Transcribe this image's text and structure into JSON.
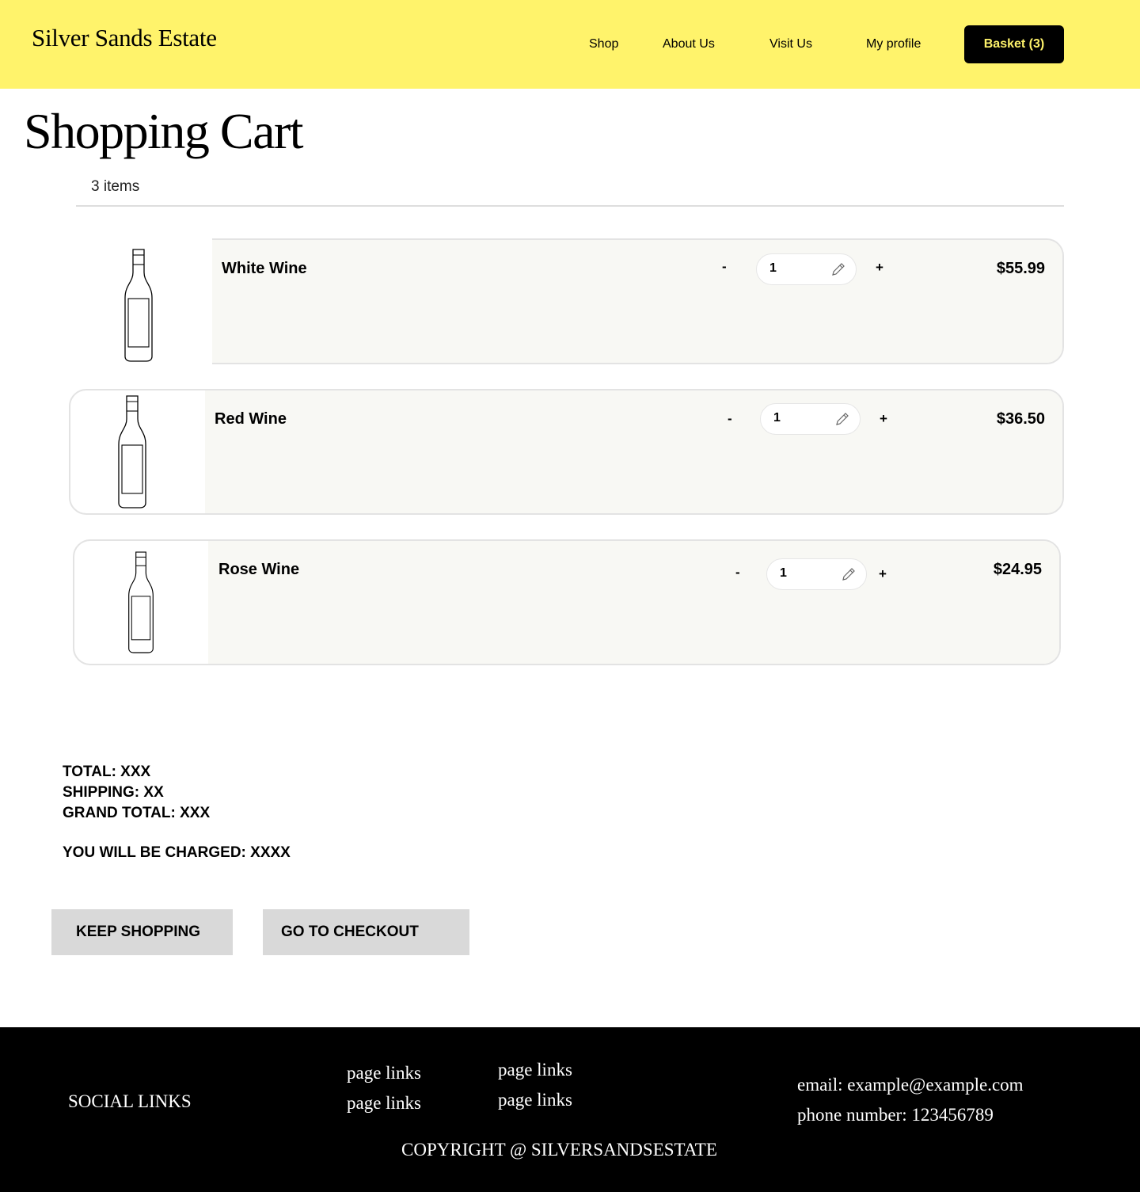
{
  "header": {
    "brand": "Silver Sands Estate",
    "nav": [
      "Shop",
      "About Us",
      "Visit Us",
      "My profile"
    ],
    "basket_label": "Basket (3)",
    "colors": {
      "background": "#fff36b",
      "basket_bg": "#000000",
      "basket_text": "#fff36b"
    }
  },
  "page": {
    "title": "Shopping Cart",
    "item_count": "3 items"
  },
  "cart": {
    "items": [
      {
        "name": "White Wine",
        "quantity": "1",
        "price": "$55.99",
        "minus": "-",
        "plus": "+",
        "icon": "wine-bottle-icon"
      },
      {
        "name": "Red Wine",
        "quantity": "1",
        "price": "$36.50",
        "minus": "-",
        "plus": "+",
        "icon": "wine-bottle-icon"
      },
      {
        "name": "Rose Wine",
        "quantity": "1",
        "price": "$24.95",
        "minus": "-",
        "plus": "+",
        "icon": "wine-bottle-icon"
      }
    ]
  },
  "summary": {
    "total": "TOTAL: XXX",
    "shipping": "SHIPPING: XX",
    "grand_total": "GRAND TOTAL: XXX",
    "charged": "YOU WILL BE CHARGED: XXXX"
  },
  "actions": {
    "keep_shopping": "KEEP SHOPPING",
    "checkout": "GO TO CHECKOUT"
  },
  "footer": {
    "social": "SOCIAL LINKS",
    "links_col1": [
      "page links",
      "page links"
    ],
    "links_col2": [
      "page links",
      "page links"
    ],
    "email": "email: example@example.com",
    "phone": "phone number: 123456789",
    "copyright": "COPYRIGHT @ SILVERSANDSESTATE"
  }
}
